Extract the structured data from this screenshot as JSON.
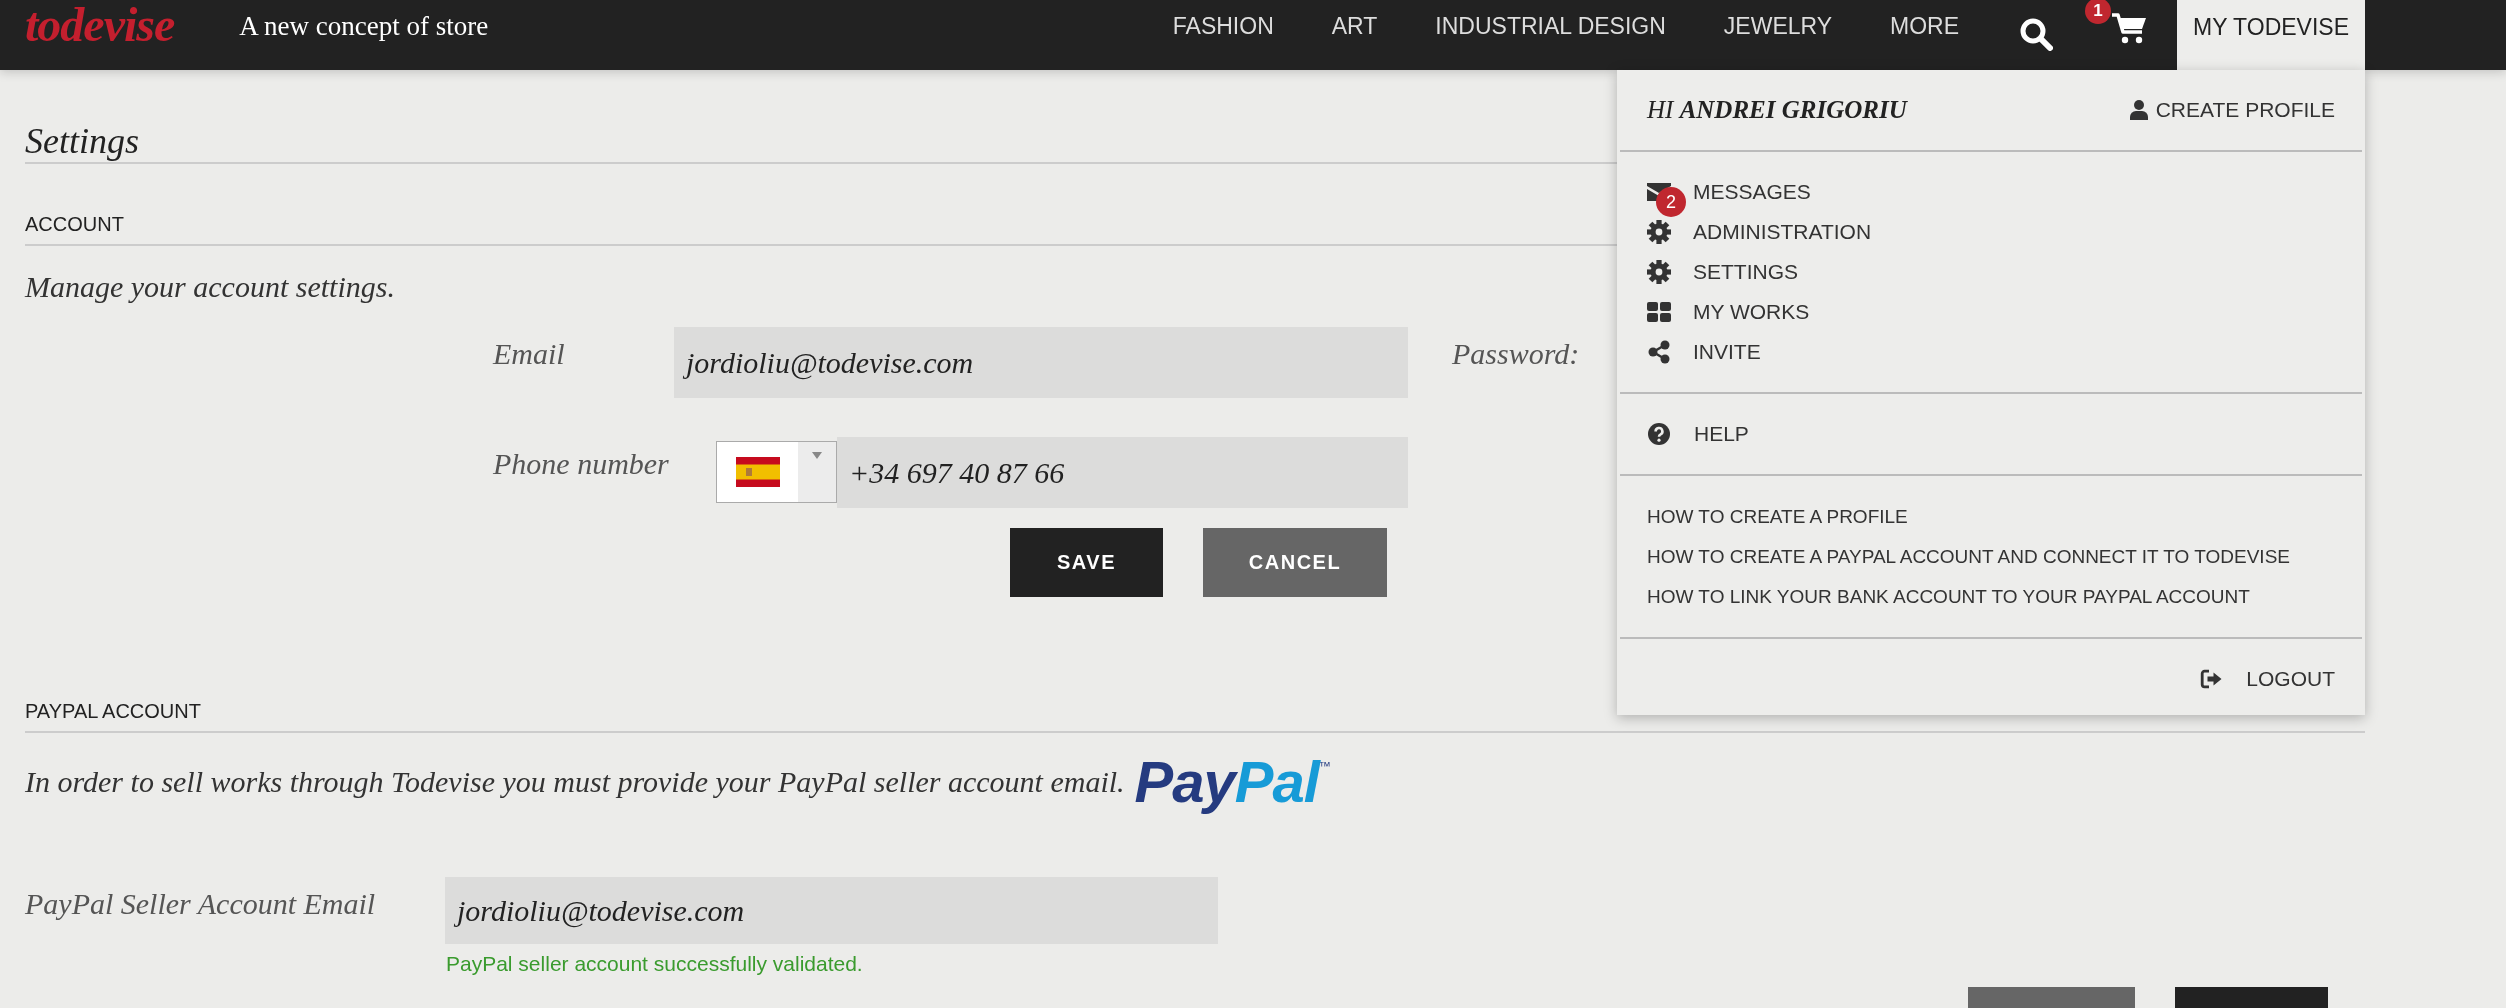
{
  "header": {
    "logo": "todevise",
    "tagline": "A new concept of store",
    "nav": [
      "FASHION",
      "ART",
      "INDUSTRIAL DESIGN",
      "JEWELRY",
      "MORE"
    ],
    "cart_badge": "1",
    "account_tab": {
      "label": "MY TODEVISE",
      "expanded": true
    }
  },
  "page_title": "Settings",
  "account": {
    "heading": "ACCOUNT",
    "intro": "Manage your account settings.",
    "email": {
      "label": "Email",
      "value": "jordioliu@todevise.com"
    },
    "phone": {
      "label": "Phone number",
      "value": "+34 697 40 87 66"
    },
    "password": {
      "label": "Password:"
    },
    "buttons": [
      {
        "label": "SAVE",
        "kind": "primary"
      },
      {
        "label": "CANCEL",
        "kind": "secondary"
      }
    ]
  },
  "paypal": {
    "heading": "PAYPAL ACCOUNT",
    "intro": "In order to sell works through Todevise you must provide your PayPal seller account email.",
    "logo": {
      "parts": [
        "Pay",
        "Pal"
      ],
      "mark": "™"
    },
    "email": {
      "label": "PayPal Seller Account Email",
      "value": "jordioliu@todevise.com"
    },
    "status": {
      "text": "PayPal seller account successfully validated.",
      "kind": "success"
    },
    "buttons": [
      {
        "kind": "secondary"
      },
      {
        "kind": "primary"
      }
    ]
  },
  "account_menu": {
    "greeting": "HI **ANDREI GRIGORIU**",
    "create_profile": "CREATE PROFILE",
    "items": [
      {
        "label": "MESSAGES",
        "badge": "2"
      },
      {
        "label": "ADMINISTRATION"
      },
      {
        "label": "SETTINGS"
      },
      {
        "label": "MY WORKS"
      },
      {
        "label": "INVITE"
      }
    ],
    "help": "HELP",
    "links": [
      "HOW TO CREATE A PROFILE",
      "HOW TO CREATE A PAYPAL ACCOUNT AND CONNECT IT TO TODEVISE",
      "HOW TO LINK YOUR BANK ACCOUNT TO YOUR PAYPAL ACCOUNT"
    ],
    "logout": "LOGOUT"
  }
}
